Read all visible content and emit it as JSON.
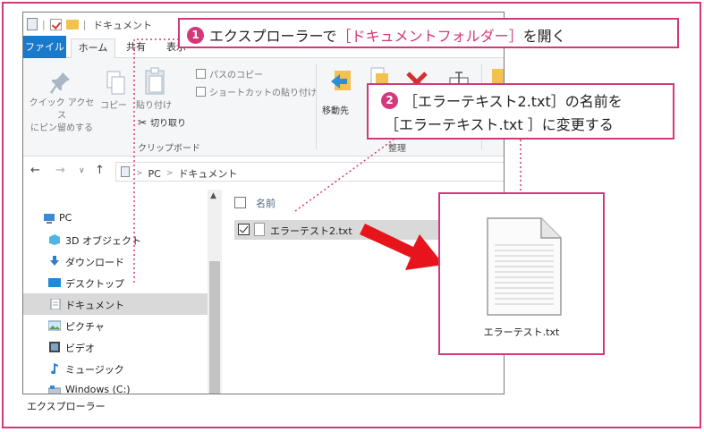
{
  "window": {
    "title": "ドキュメント",
    "tabs": {
      "file": "ファイル",
      "home": "ホーム",
      "share": "共有",
      "view": "表示"
    }
  },
  "ribbon": {
    "pin_label": "クイック アクセス\nにピン留めする",
    "copy_label": "コピー",
    "paste_label": "貼り付け",
    "path_copy_label": "パスのコピー",
    "shortcut_paste_label": "ショートカットの貼り付け",
    "cut_label": "切り取り",
    "clipboard_group": "クリップボード",
    "move_label": "移動先",
    "organize_group": "整理"
  },
  "address": {
    "segments": [
      "PC",
      "ドキュメント"
    ]
  },
  "nav_pane": {
    "items": [
      {
        "label": "PC",
        "icon": "pc-icon"
      },
      {
        "label": "3D オブジェクト",
        "icon": "3d-objects-icon"
      },
      {
        "label": "ダウンロード",
        "icon": "download-icon"
      },
      {
        "label": "デスクトップ",
        "icon": "desktop-icon"
      },
      {
        "label": "ドキュメント",
        "icon": "document-icon",
        "selected": true
      },
      {
        "label": "ピクチャ",
        "icon": "pictures-icon"
      },
      {
        "label": "ビデオ",
        "icon": "video-icon"
      },
      {
        "label": "ミュージック",
        "icon": "music-icon"
      },
      {
        "label": "Windows (C:)",
        "icon": "drive-icon"
      }
    ]
  },
  "content": {
    "column_name": "名前",
    "files": [
      {
        "name": "エラーテスト2.txt",
        "checked": true
      }
    ]
  },
  "callouts": {
    "step1": {
      "number": "1",
      "text_before": "エクスプローラーで",
      "text_accent": "［ドキュメントフォルダー］",
      "text_after": "を開く"
    },
    "step2": {
      "number": "2",
      "line1": "［エラーテキスト2.txt］の名前を",
      "line2": "［エラーテキスト.txt ］に変更する"
    }
  },
  "result": {
    "file_name": "エラーテスト.txt"
  },
  "caption": "エクスプローラー",
  "colors": {
    "accent": "#d4387a",
    "arrow": "#e8141c",
    "ribbon_file_tab": "#1979ca"
  }
}
